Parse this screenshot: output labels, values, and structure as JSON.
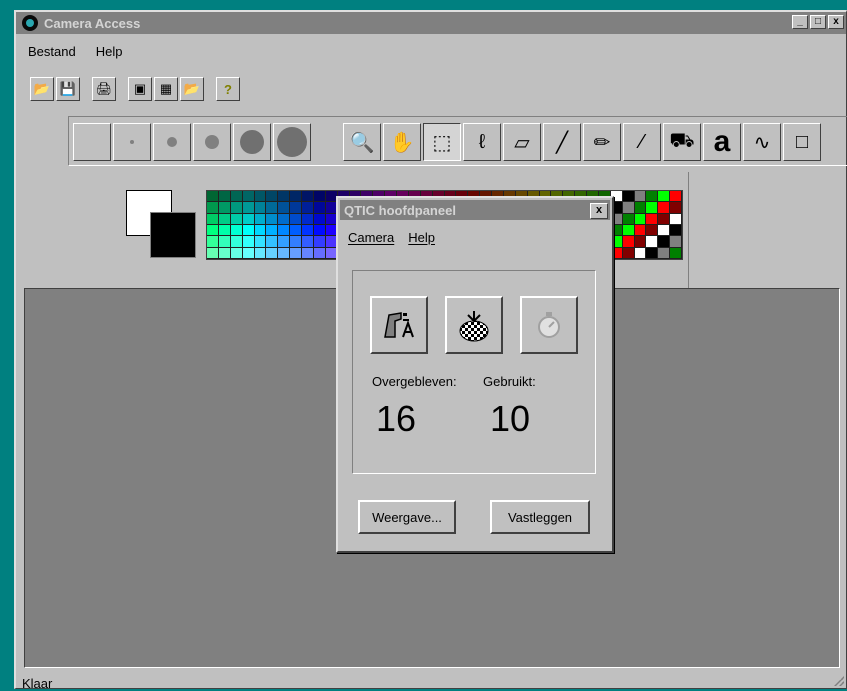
{
  "window": {
    "title": "Camera Access",
    "min": "_",
    "max": "□",
    "close": "x"
  },
  "menu": [
    "Bestand",
    "Help"
  ],
  "toolbar": {
    "open_icon": "📂",
    "save_icon": "💾",
    "print_icon": "🖨",
    "camera_icon": "▣",
    "calendar_icon": "▦",
    "folder_icon": "📂",
    "help_icon": "?"
  },
  "tools": {
    "zoom": "🔍",
    "hand": "✋",
    "select": "⬚",
    "lasso": "ℓ",
    "eraser": "▱",
    "brush": "╱",
    "pencil": "✏",
    "picker": "⁄",
    "fill": "⛟",
    "text": "a",
    "smudge": "∿",
    "more": "□"
  },
  "status": {
    "text": "Klaar"
  },
  "dialog": {
    "title": "QTIC hoofdpaneel",
    "close": "x",
    "menu": [
      "Camera",
      "Help"
    ],
    "labels": {
      "remaining": "Overgebleven:",
      "used": "Gebruikt:"
    },
    "values": {
      "remaining": "16",
      "used": "10"
    },
    "buttons": {
      "view": "Weergave...",
      "capture": "Vastleggen"
    }
  },
  "colors": {
    "title_bar": "#808080",
    "face": "#c0c0c0",
    "desktop": "#008080",
    "canvas": "#808080"
  }
}
